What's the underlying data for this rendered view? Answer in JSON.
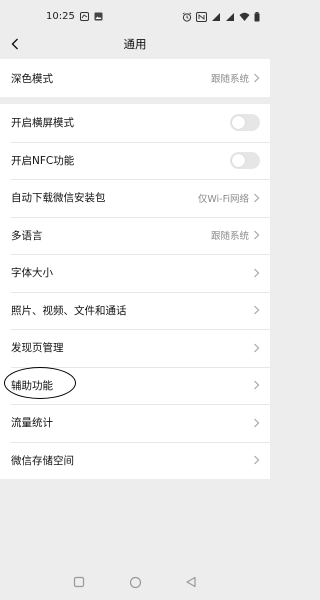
{
  "status_bar": {
    "time": "10:25",
    "left_icons": [
      "weibo-notification-icon",
      "image-notification-icon"
    ],
    "right_icons": [
      "alarm-icon",
      "nfc-icon",
      "signal-icon",
      "signal-icon",
      "wifi-icon",
      "battery-icon"
    ]
  },
  "header": {
    "title": "通用",
    "back_icon": "chevron-left-icon"
  },
  "settings": {
    "dark_mode": {
      "label": "深色模式",
      "value": "跟随系统"
    },
    "landscape": {
      "label": "开启横屏模式",
      "enabled": false
    },
    "nfc": {
      "label": "开启NFC功能",
      "enabled": false
    },
    "auto_download": {
      "label": "自动下载微信安装包",
      "value": "仅Wi-Fi网络"
    },
    "language": {
      "label": "多语言",
      "value": "跟随系统"
    },
    "font_size": {
      "label": "字体大小"
    },
    "media": {
      "label": "照片、视频、文件和通话"
    },
    "discover": {
      "label": "发现页管理"
    },
    "accessibility": {
      "label": "辅助功能"
    },
    "data_usage": {
      "label": "流量统计"
    },
    "storage": {
      "label": "微信存储空间"
    }
  },
  "system_nav": {
    "icons": [
      "recent-apps-icon",
      "home-icon",
      "back-triangle-icon"
    ]
  },
  "colors": {
    "background": "#ededed",
    "row_background": "#ffffff",
    "secondary_text": "#8c8c8c",
    "toggle_off": "#e6e6e6"
  }
}
